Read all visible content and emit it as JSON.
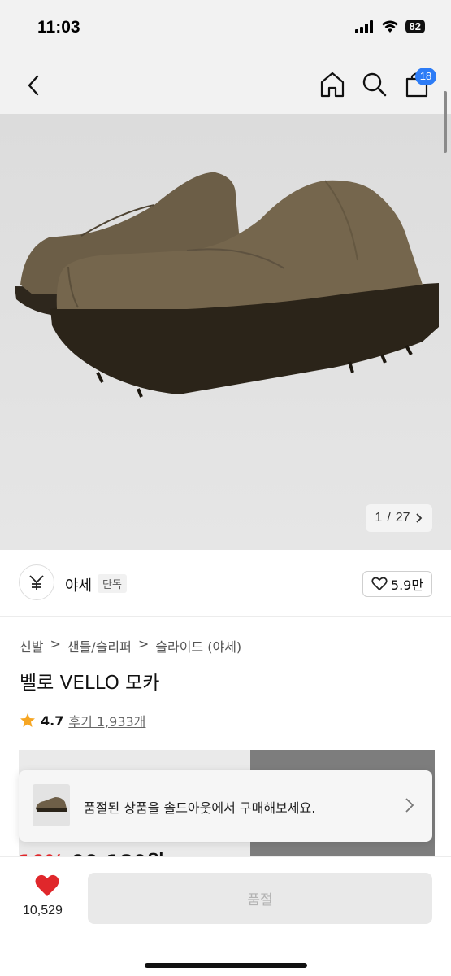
{
  "status_bar": {
    "time": "11:03",
    "battery": "82"
  },
  "nav": {
    "cart_count": "18"
  },
  "gallery": {
    "current": "1",
    "separator": "/",
    "total": "27"
  },
  "brand": {
    "name": "야세",
    "tag": "단독",
    "likes": "5.9만"
  },
  "breadcrumb": [
    "신발",
    ">",
    "샌들/슬리퍼",
    ">",
    "슬라이드 (야세)"
  ],
  "product": {
    "title": "벨로 VELLO 모카",
    "rating": "4.7",
    "review_text": "후기 1,933개"
  },
  "price_peek": {
    "discount": "10%",
    "price": "99,180원"
  },
  "toast": {
    "message": "품절된 상품을 솔드아웃에서 구매해보세요."
  },
  "bottom_bar": {
    "wish_count": "10,529",
    "button_label": "품절"
  },
  "colors": {
    "accent_red": "#e0272b",
    "badge_blue": "#2d7cf6",
    "star": "#f6a623"
  }
}
